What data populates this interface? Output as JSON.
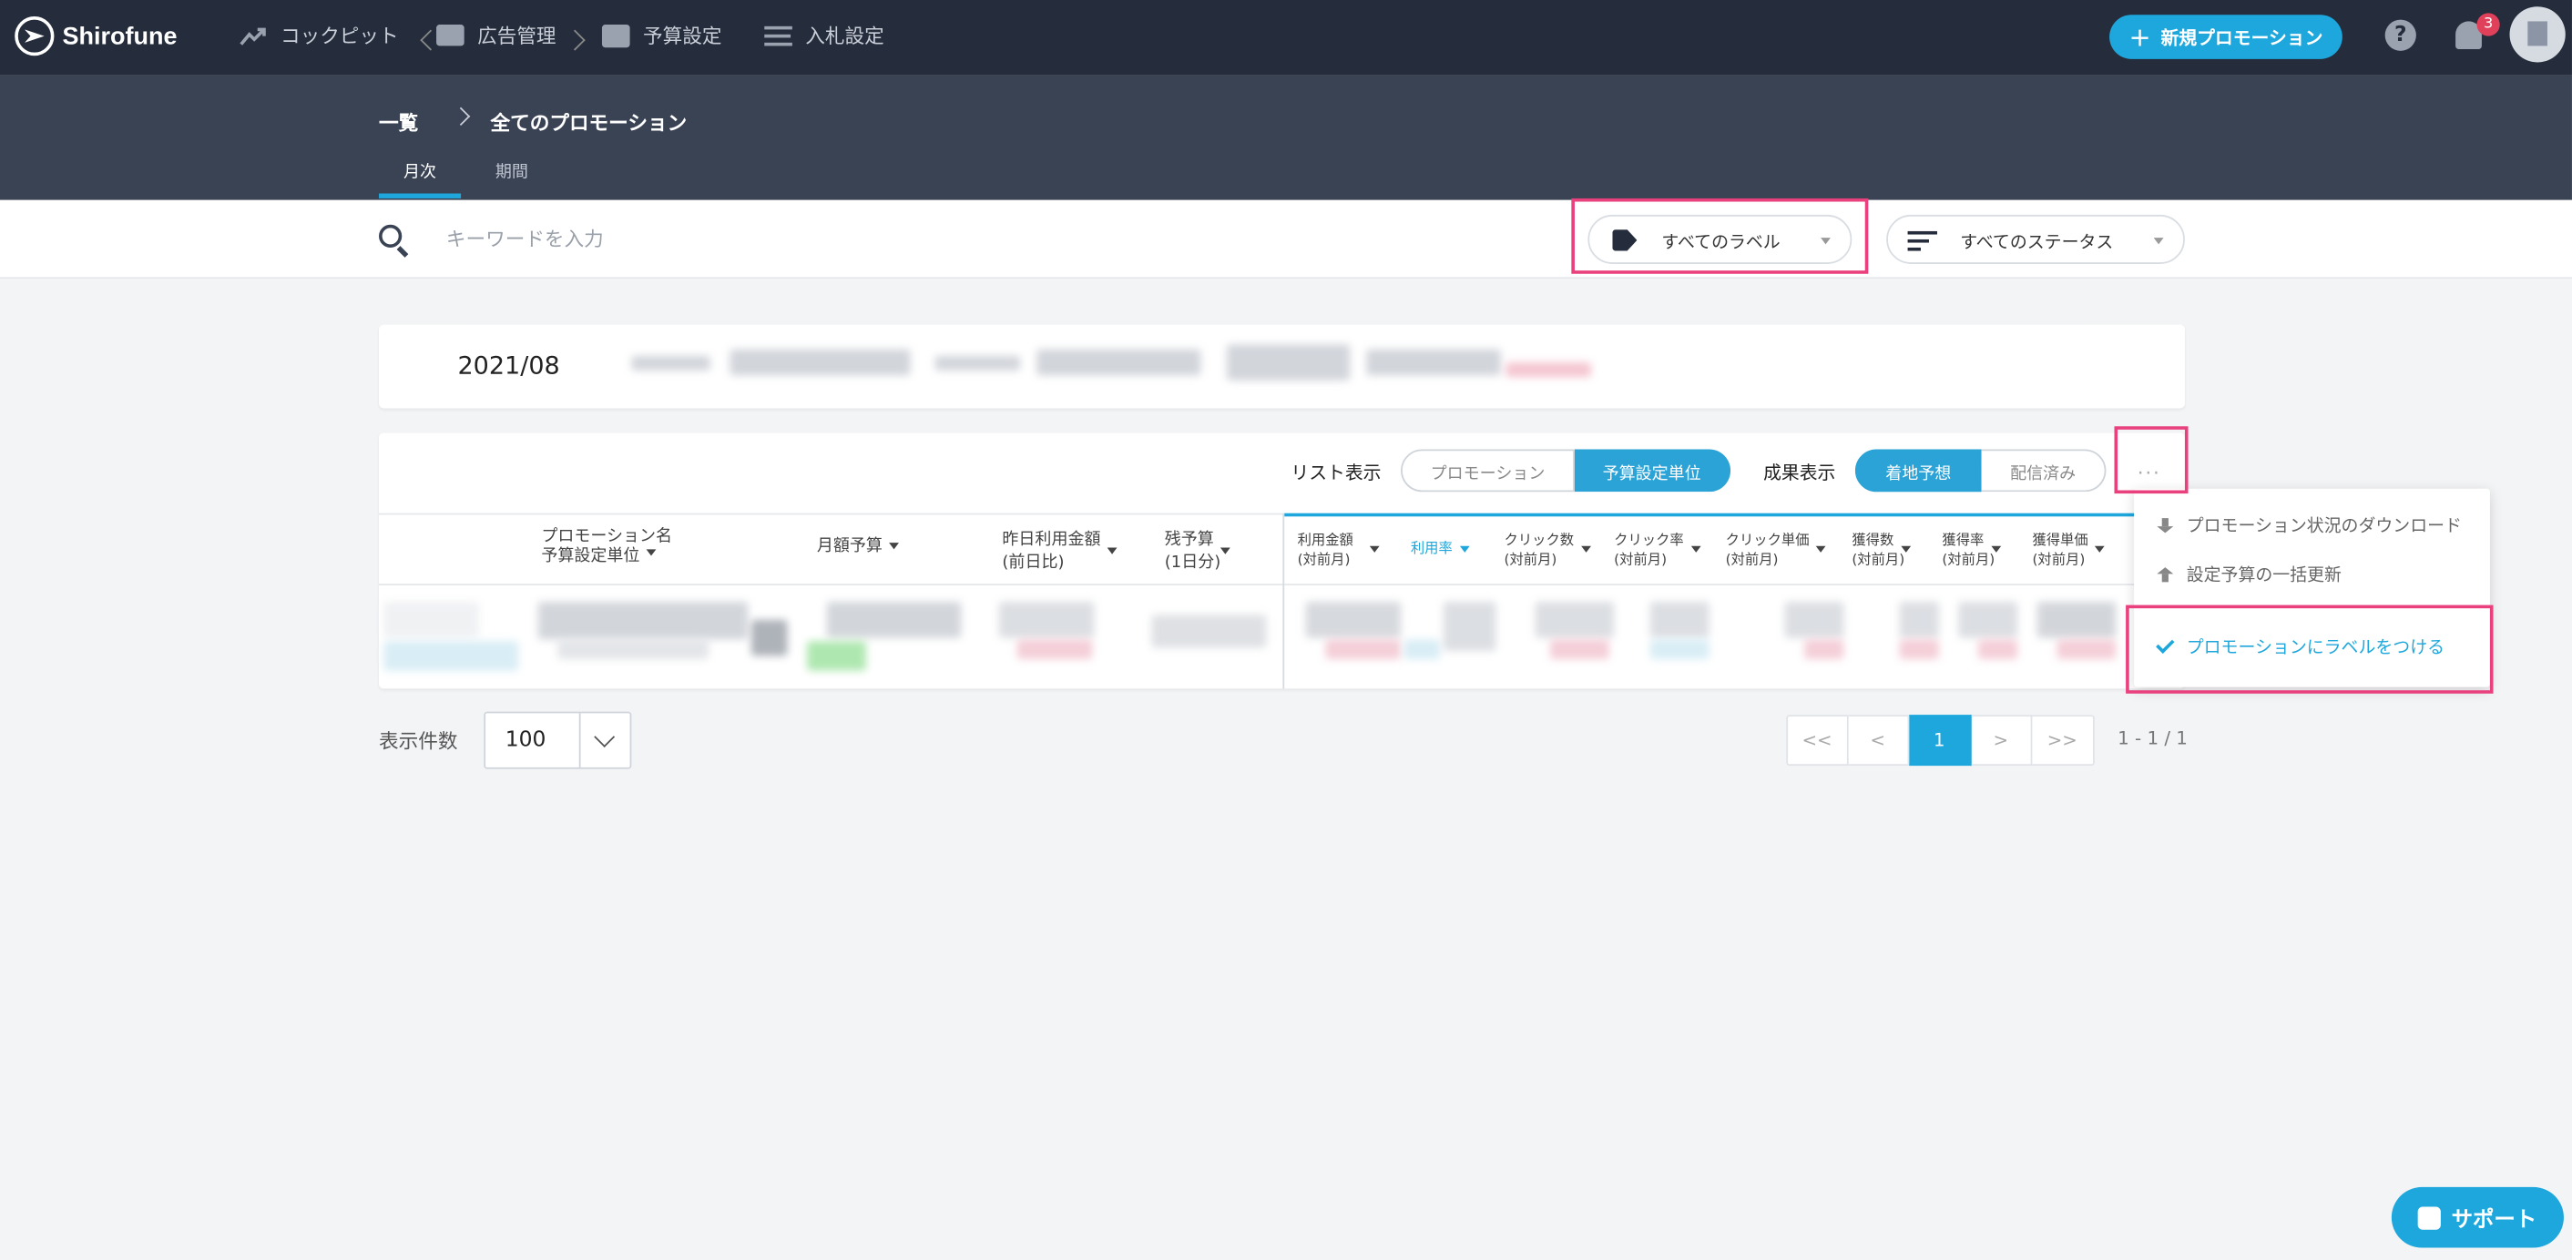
{
  "app": {
    "name": "Shirofune"
  },
  "nav": {
    "items": [
      {
        "label": "コックピット",
        "icon": "trend-icon"
      },
      {
        "label": "広告管理",
        "icon": "folder-icon"
      },
      {
        "label": "予算設定",
        "icon": "wallet-icon"
      },
      {
        "label": "入札設定",
        "icon": "sliders-icon"
      }
    ],
    "new_promotion": "新規プロモーション",
    "notification_count": "3"
  },
  "breadcrumb": {
    "home": "一覧",
    "current": "全てのプロモーション"
  },
  "subtabs": {
    "monthly": "月次",
    "period": "期間"
  },
  "search": {
    "placeholder": "キーワードを入力",
    "value": ""
  },
  "filters": {
    "label": "すべてのラベル",
    "status": "すべてのステータス"
  },
  "month": {
    "value": "2021/08"
  },
  "list_view": {
    "label": "リスト表示",
    "options": [
      "プロモーション",
      "予算設定単位"
    ],
    "selected": "予算設定単位"
  },
  "result_view": {
    "label": "成果表示",
    "options": [
      "着地予想",
      "配信済み"
    ],
    "selected": "着地予想"
  },
  "more_button": "...",
  "columns": {
    "name": [
      "プロモーション名",
      "予算設定単位"
    ],
    "monthly_budget": "月額予算",
    "yesterday_spend": [
      "昨日利用金額",
      "(前日比)"
    ],
    "remaining": [
      "残予算",
      "(1日分)"
    ],
    "spend": [
      "利用金額",
      "(対前月)"
    ],
    "usage_rate": "利用率",
    "clicks": [
      "クリック数",
      "(対前月)"
    ],
    "ctr": [
      "クリック率",
      "(対前月)"
    ],
    "cpc": [
      "クリック単価",
      "(対前月)"
    ],
    "conversions": [
      "獲得数",
      "(対前月)"
    ],
    "cvr": [
      "獲得率",
      "(対前月)"
    ],
    "cpa": [
      "獲得単価",
      "(対前月)"
    ]
  },
  "menu": {
    "download": "プロモーション状況のダウンロード",
    "bulk_update": "設定予算の一括更新",
    "add_label": "プロモーションにラベルをつける"
  },
  "footer": {
    "perpage_label": "表示件数",
    "perpage_value": "100",
    "pages": [
      "<<",
      "<",
      "1",
      ">",
      ">>"
    ],
    "active_page": "1",
    "range": "1 - 1 / 1"
  },
  "support": {
    "label": "サポート"
  }
}
